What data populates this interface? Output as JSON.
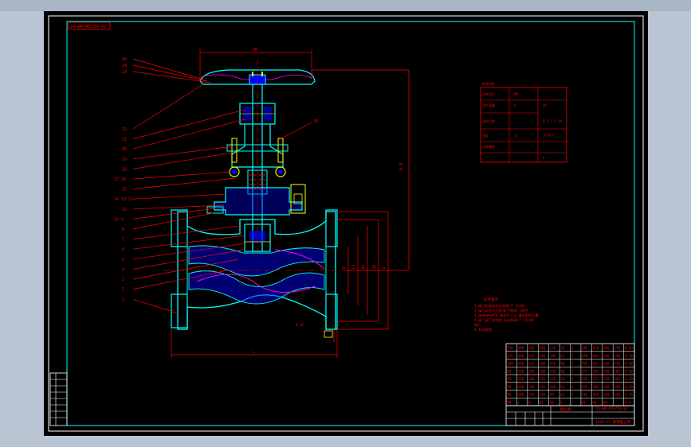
{
  "drawing": {
    "code_box": "ZG-ф#(dN)25G-02",
    "balloons_left": [
      "26",
      "24",
      "23",
      "22",
      "21",
      "20",
      "19",
      "18",
      "17 16",
      "15",
      "14 13 12",
      "11",
      "10 9",
      "8",
      "7",
      "6",
      "5",
      "4",
      "3",
      "2",
      "1"
    ],
    "balloon_right": "25",
    "dim_top": "D0",
    "dim_right": "H B",
    "dim_bottom": "L",
    "dim_face": [
      "D",
      "D1",
      "D2",
      "D6",
      "D"
    ],
    "dim_flange": "Z-d",
    "tech_table_title": "技术特性",
    "tech_table": [
      [
        "公称压力",
        "PN",
        "",
        ""
      ],
      [
        "工作温度",
        "t",
        "24",
        ""
      ],
      [
        "适用介质",
        "",
        "P 5.7  2 18",
        ""
      ],
      [
        "试验",
        "水",
        "水/空气",
        ""
      ],
      [
        "公称通径",
        "",
        "",
        ""
      ],
      [
        "",
        "",
        "P",
        "40"
      ]
    ],
    "notes_title": "技术要求",
    "notes": [
      "1.阀门制造验收符合GB/T 12232",
      "2.阀门试验压力按JB/T9092-1999",
      "3.阀体材料WCB,阀杆2Cr13,填料柔性石墨",
      "4.阀门出厂前涂漆,标志按GB/T 12220",
      "  执行",
      "5.其他按图"
    ],
    "size_table": [
      [
        "150",
        "480",
        "285",
        "240",
        "210",
        "24",
        "3",
        "483",
        "538",
        "380",
        "278",
        "8-23"
      ],
      [
        "125",
        "400",
        "245",
        "210",
        "185",
        "22",
        "3",
        "458",
        "494",
        "280",
        "250",
        "8-18"
      ],
      [
        "100",
        "350",
        "215",
        "180",
        "155",
        "20",
        "3",
        "424",
        "457",
        "280",
        "230",
        "8-18"
      ],
      [
        "80",
        "310",
        "195",
        "160",
        "135",
        "20",
        "3",
        "377",
        "393",
        "240",
        "180",
        "8-18"
      ],
      [
        "65",
        "290",
        "180",
        "145",
        "120",
        "18",
        "3",
        "346",
        "353",
        "240",
        "166",
        "4-18"
      ],
      [
        "50",
        "250",
        "160",
        "125",
        "100",
        "16",
        "3",
        "276",
        "286",
        "180",
        "140",
        "4-18"
      ],
      [
        "40",
        "200",
        "145",
        "110",
        "85",
        "16",
        "3",
        "262",
        "266",
        "160",
        "120",
        "4-18"
      ],
      [
        "DN",
        "L",
        "D",
        "D1",
        "D2",
        "b",
        "f",
        "H1",
        "H2",
        "D0",
        "",
        "Z-d"
      ]
    ],
    "title_block_name": "截止阀",
    "title_block_sub": "J41H-25 铸钢截止阀",
    "title_block_drawing_no": "ZG-ф#(dN)25G-02",
    "left_block": [
      "",
      "",
      "",
      "",
      "",
      "",
      "",
      ""
    ]
  },
  "colors": {
    "background": "#000000",
    "frame": "#ffffff",
    "section_lines": "#00ffff",
    "dimension": "#ff0000",
    "hatch": "#0000ff",
    "magenta": "#ff00ff",
    "highlight": "#ffff00"
  }
}
